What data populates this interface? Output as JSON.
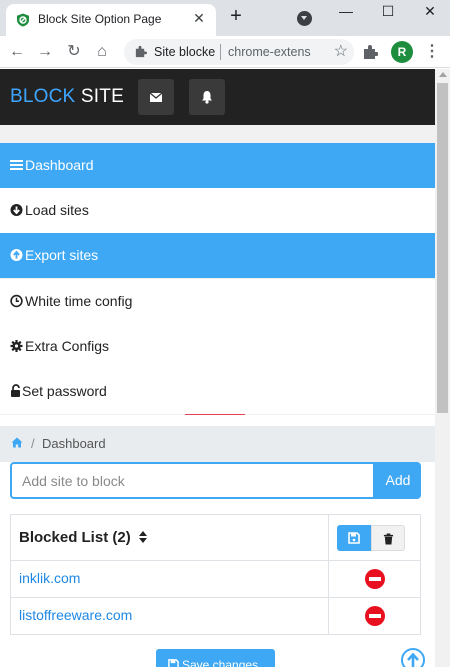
{
  "browser": {
    "tab_title": "Block Site Option Page",
    "tab_close": "✕",
    "new_tab": "+",
    "address_site": "Site blocke",
    "address_url": "chrome-extens",
    "profile_initial": "R",
    "window_controls": {
      "minimize": "—",
      "maximize": "☐",
      "close": "✕"
    },
    "nav": {
      "back": "←",
      "forward": "→",
      "reload": "↻",
      "home": "⌂"
    },
    "bookmark_star": "☆",
    "menu": "⋮"
  },
  "header": {
    "brand_part1": "BLOCK",
    "brand_part2": "SITE",
    "buttons": [
      {
        "icon": "envelope-icon"
      },
      {
        "icon": "bell-icon"
      }
    ]
  },
  "sidebar": {
    "items": [
      {
        "label": "Dashboard",
        "icon": "list-icon",
        "active": true
      },
      {
        "label": "Load sites",
        "icon": "arrow-circle-down-icon",
        "active": false
      },
      {
        "label": "Export sites",
        "icon": "arrow-circle-up-icon",
        "active": true
      },
      {
        "label": "White time config",
        "icon": "clock-icon",
        "active": false
      },
      {
        "label": "Extra Configs",
        "icon": "gear-icon",
        "active": false
      },
      {
        "label": "Set password",
        "icon": "unlock-icon",
        "active": false
      }
    ]
  },
  "breadcrumb": {
    "separator": "/",
    "current": "Dashboard"
  },
  "add_site": {
    "placeholder": "Add site to block",
    "button_label": "Add"
  },
  "blocked_list": {
    "title": "Blocked List (2)",
    "sites": [
      "inklik.com",
      "listoffreeware.com"
    ]
  },
  "footer": {
    "save_label": "Save changes"
  },
  "colors": {
    "accent": "#3ea8f5",
    "header_bg": "#222222",
    "remove_red": "#e8101f"
  }
}
